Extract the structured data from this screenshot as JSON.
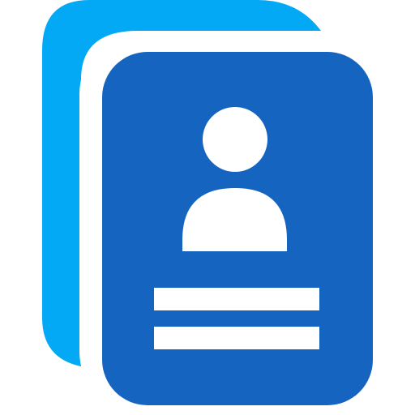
{
  "icon": {
    "name": "contact-cards-icon",
    "colors": {
      "back_card": "#03A9F4",
      "front_card": "#1565C0",
      "gap": "#FFFFFF",
      "figure": "#FFFFFF"
    }
  }
}
